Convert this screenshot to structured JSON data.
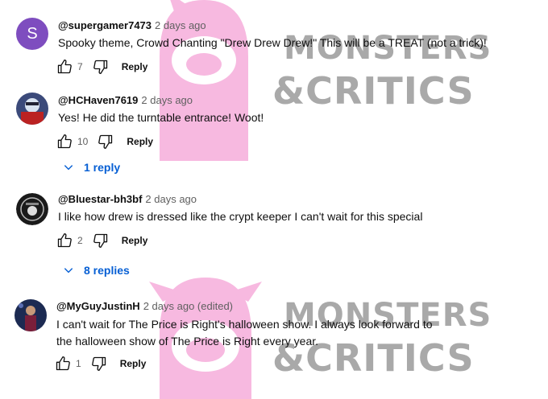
{
  "watermark": {
    "line1": "MONSTERS",
    "line2": "&CRITICS"
  },
  "comments": [
    {
      "author": "@supergamer7473",
      "time": "2 days ago",
      "avatar_letter": "S",
      "text": [
        "Spooky theme, Crowd Chanting \"Drew Drew Drew!\" This will be a TREAT (not a trick)!"
      ],
      "likes": "7",
      "reply_label": "Reply"
    },
    {
      "author": "@HCHaven7619",
      "time": "2 days ago",
      "text": [
        "Yes!  He did the turntable entrance!  Woot!"
      ],
      "likes": "10",
      "reply_label": "Reply",
      "replies_label": "1 reply"
    },
    {
      "author": "@Bluestar-bh3bf",
      "time": "2 days ago",
      "text": [
        "I like how drew is dressed like the crypt keeper I can't wait for this special"
      ],
      "likes": "2",
      "reply_label": "Reply",
      "replies_label": "8 replies"
    },
    {
      "author": "@MyGuyJustinH",
      "time": "2 days ago (edited)",
      "text": [
        "I can't wait for The Price is Right's halloween show. I always look forward to",
        "the halloween show of The Price is Right every year."
      ],
      "likes": "1",
      "reply_label": "Reply"
    }
  ],
  "colors": {
    "avatar_purple": "#7e4dbf",
    "link_blue": "#065fd4",
    "watermark_pink": "#f7b9e0"
  }
}
